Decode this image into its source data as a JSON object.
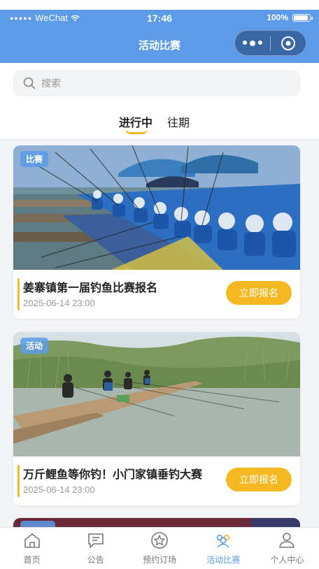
{
  "status_bar": {
    "carrier": "WeChat",
    "time": "17:46",
    "battery": "100%",
    "battery_level": 1.0
  },
  "nav": {
    "title": "活动比赛"
  },
  "search": {
    "placeholder": "搜索",
    "icon": "search-icon"
  },
  "tabs": [
    {
      "label": "进行中",
      "active": true
    },
    {
      "label": "往期",
      "active": false
    }
  ],
  "cards": [
    {
      "badge": "比赛",
      "title": "姜寨镇第一届钓鱼比赛报名",
      "date": "2025-06-14 23:00",
      "button": "立即报名"
    },
    {
      "badge": "活动",
      "title": "万斤鲤鱼等你钓！小门家镇垂钓大赛",
      "date": "2025-06-14 23:00",
      "button": "立即报名"
    }
  ],
  "tabbar": [
    {
      "label": "首页",
      "icon": "home-icon",
      "active": false
    },
    {
      "label": "公告",
      "icon": "announcement-icon",
      "active": false
    },
    {
      "label": "预约订场",
      "icon": "star-booking-icon",
      "active": false
    },
    {
      "label": "活动比赛",
      "icon": "users-icon",
      "active": true
    },
    {
      "label": "个人中心",
      "icon": "user-icon",
      "active": false
    }
  ],
  "colors": {
    "header": "#5b9be8",
    "accent": "#f5b820",
    "active_tab": "#5b9be8"
  }
}
